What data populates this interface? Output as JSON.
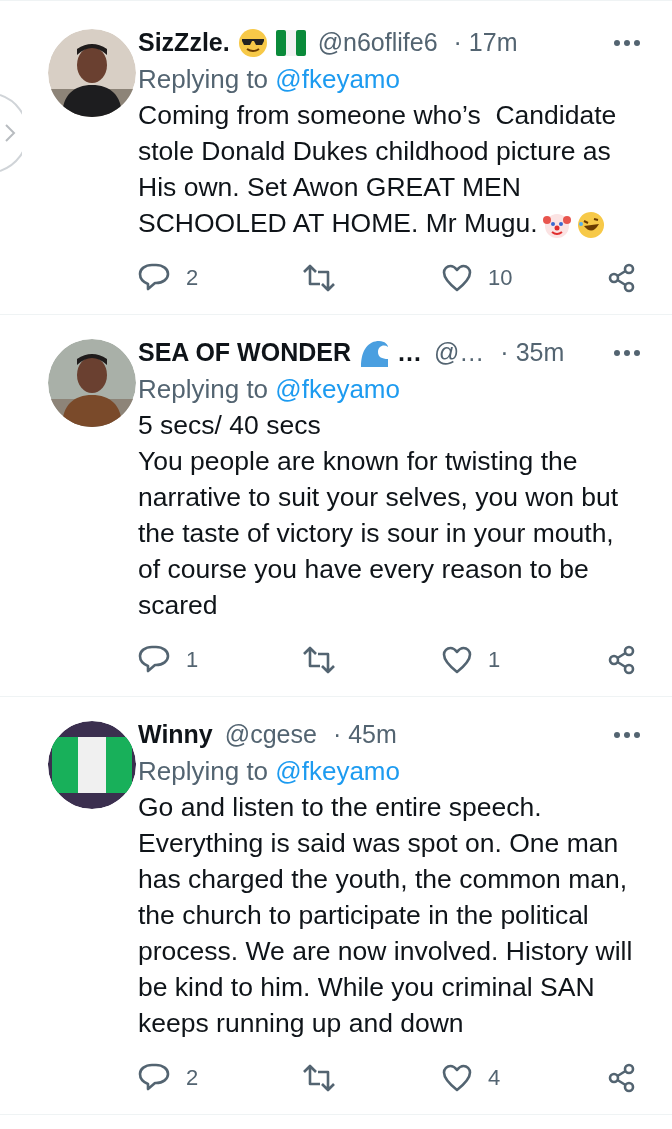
{
  "tweets": [
    {
      "name": "SizZzle.",
      "name_icons": [
        {
          "kind": "sunglasses"
        },
        {
          "kind": "flag"
        }
      ],
      "handle": "@n6oflife6",
      "time": "· 17m",
      "avatar": {
        "kind": "picture"
      },
      "replying_label": "Replying to",
      "replying_to": "@fkeyamo",
      "lines": [
        "Coming from someone who’s  Candidate stole Donald Dukes childhood picture as His own. Set Awon GREAT MEN SCHOOLED AT HOME. Mr Mugu."
      ],
      "body_icons": [
        {
          "kind": "clown"
        },
        {
          "kind": "laughing"
        }
      ],
      "replies": "2",
      "likes": "10"
    },
    {
      "name": "SEA OF WONDER",
      "name_icons": [
        {
          "kind": "wave"
        }
      ],
      "name_suffix": "…",
      "handle": "@…",
      "time": "· 35m",
      "avatar": {
        "kind": "picture"
      },
      "replying_label": "Replying to",
      "replying_to": "@fkeyamo",
      "lines": [
        "5 secs/ 40 secs",
        "You people are known for twisting the narrative to suit your selves, you won but the taste of victory is sour in your mouth, of course you have every reason to be scared"
      ],
      "replies": "1",
      "likes": "1"
    },
    {
      "name": "Winny",
      "handle": "@cgese",
      "time": "· 45m",
      "avatar": {
        "kind": "picture"
      },
      "replying_label": "Replying to",
      "replying_to": "@fkeyamo",
      "lines": [
        "Go and listen to the entire speech. Everything is said was spot on. One man has charged the youth, the common man, the church to participate in the political process. We are now involved. History will be kind to him. While you criminal SAN keeps running up and down"
      ],
      "replies": "2",
      "likes": "4"
    }
  ]
}
